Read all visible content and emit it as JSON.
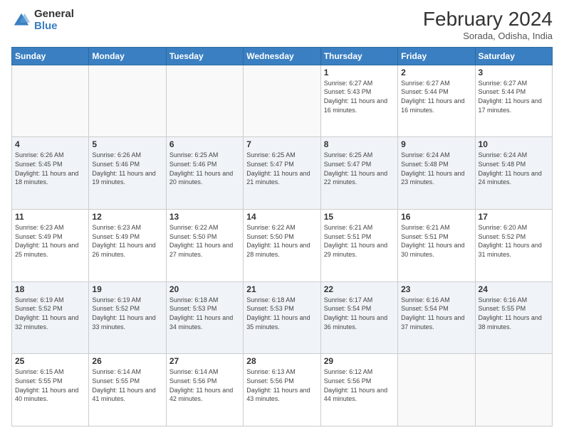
{
  "header": {
    "logo_general": "General",
    "logo_blue": "Blue",
    "month_title": "February 2024",
    "subtitle": "Sorada, Odisha, India"
  },
  "days_of_week": [
    "Sunday",
    "Monday",
    "Tuesday",
    "Wednesday",
    "Thursday",
    "Friday",
    "Saturday"
  ],
  "weeks": [
    [
      {
        "day": "",
        "info": ""
      },
      {
        "day": "",
        "info": ""
      },
      {
        "day": "",
        "info": ""
      },
      {
        "day": "",
        "info": ""
      },
      {
        "day": "1",
        "info": "Sunrise: 6:27 AM\nSunset: 5:43 PM\nDaylight: 11 hours and 16 minutes."
      },
      {
        "day": "2",
        "info": "Sunrise: 6:27 AM\nSunset: 5:44 PM\nDaylight: 11 hours and 16 minutes."
      },
      {
        "day": "3",
        "info": "Sunrise: 6:27 AM\nSunset: 5:44 PM\nDaylight: 11 hours and 17 minutes."
      }
    ],
    [
      {
        "day": "4",
        "info": "Sunrise: 6:26 AM\nSunset: 5:45 PM\nDaylight: 11 hours and 18 minutes."
      },
      {
        "day": "5",
        "info": "Sunrise: 6:26 AM\nSunset: 5:46 PM\nDaylight: 11 hours and 19 minutes."
      },
      {
        "day": "6",
        "info": "Sunrise: 6:25 AM\nSunset: 5:46 PM\nDaylight: 11 hours and 20 minutes."
      },
      {
        "day": "7",
        "info": "Sunrise: 6:25 AM\nSunset: 5:47 PM\nDaylight: 11 hours and 21 minutes."
      },
      {
        "day": "8",
        "info": "Sunrise: 6:25 AM\nSunset: 5:47 PM\nDaylight: 11 hours and 22 minutes."
      },
      {
        "day": "9",
        "info": "Sunrise: 6:24 AM\nSunset: 5:48 PM\nDaylight: 11 hours and 23 minutes."
      },
      {
        "day": "10",
        "info": "Sunrise: 6:24 AM\nSunset: 5:48 PM\nDaylight: 11 hours and 24 minutes."
      }
    ],
    [
      {
        "day": "11",
        "info": "Sunrise: 6:23 AM\nSunset: 5:49 PM\nDaylight: 11 hours and 25 minutes."
      },
      {
        "day": "12",
        "info": "Sunrise: 6:23 AM\nSunset: 5:49 PM\nDaylight: 11 hours and 26 minutes."
      },
      {
        "day": "13",
        "info": "Sunrise: 6:22 AM\nSunset: 5:50 PM\nDaylight: 11 hours and 27 minutes."
      },
      {
        "day": "14",
        "info": "Sunrise: 6:22 AM\nSunset: 5:50 PM\nDaylight: 11 hours and 28 minutes."
      },
      {
        "day": "15",
        "info": "Sunrise: 6:21 AM\nSunset: 5:51 PM\nDaylight: 11 hours and 29 minutes."
      },
      {
        "day": "16",
        "info": "Sunrise: 6:21 AM\nSunset: 5:51 PM\nDaylight: 11 hours and 30 minutes."
      },
      {
        "day": "17",
        "info": "Sunrise: 6:20 AM\nSunset: 5:52 PM\nDaylight: 11 hours and 31 minutes."
      }
    ],
    [
      {
        "day": "18",
        "info": "Sunrise: 6:19 AM\nSunset: 5:52 PM\nDaylight: 11 hours and 32 minutes."
      },
      {
        "day": "19",
        "info": "Sunrise: 6:19 AM\nSunset: 5:52 PM\nDaylight: 11 hours and 33 minutes."
      },
      {
        "day": "20",
        "info": "Sunrise: 6:18 AM\nSunset: 5:53 PM\nDaylight: 11 hours and 34 minutes."
      },
      {
        "day": "21",
        "info": "Sunrise: 6:18 AM\nSunset: 5:53 PM\nDaylight: 11 hours and 35 minutes."
      },
      {
        "day": "22",
        "info": "Sunrise: 6:17 AM\nSunset: 5:54 PM\nDaylight: 11 hours and 36 minutes."
      },
      {
        "day": "23",
        "info": "Sunrise: 6:16 AM\nSunset: 5:54 PM\nDaylight: 11 hours and 37 minutes."
      },
      {
        "day": "24",
        "info": "Sunrise: 6:16 AM\nSunset: 5:55 PM\nDaylight: 11 hours and 38 minutes."
      }
    ],
    [
      {
        "day": "25",
        "info": "Sunrise: 6:15 AM\nSunset: 5:55 PM\nDaylight: 11 hours and 40 minutes."
      },
      {
        "day": "26",
        "info": "Sunrise: 6:14 AM\nSunset: 5:55 PM\nDaylight: 11 hours and 41 minutes."
      },
      {
        "day": "27",
        "info": "Sunrise: 6:14 AM\nSunset: 5:56 PM\nDaylight: 11 hours and 42 minutes."
      },
      {
        "day": "28",
        "info": "Sunrise: 6:13 AM\nSunset: 5:56 PM\nDaylight: 11 hours and 43 minutes."
      },
      {
        "day": "29",
        "info": "Sunrise: 6:12 AM\nSunset: 5:56 PM\nDaylight: 11 hours and 44 minutes."
      },
      {
        "day": "",
        "info": ""
      },
      {
        "day": "",
        "info": ""
      }
    ]
  ]
}
